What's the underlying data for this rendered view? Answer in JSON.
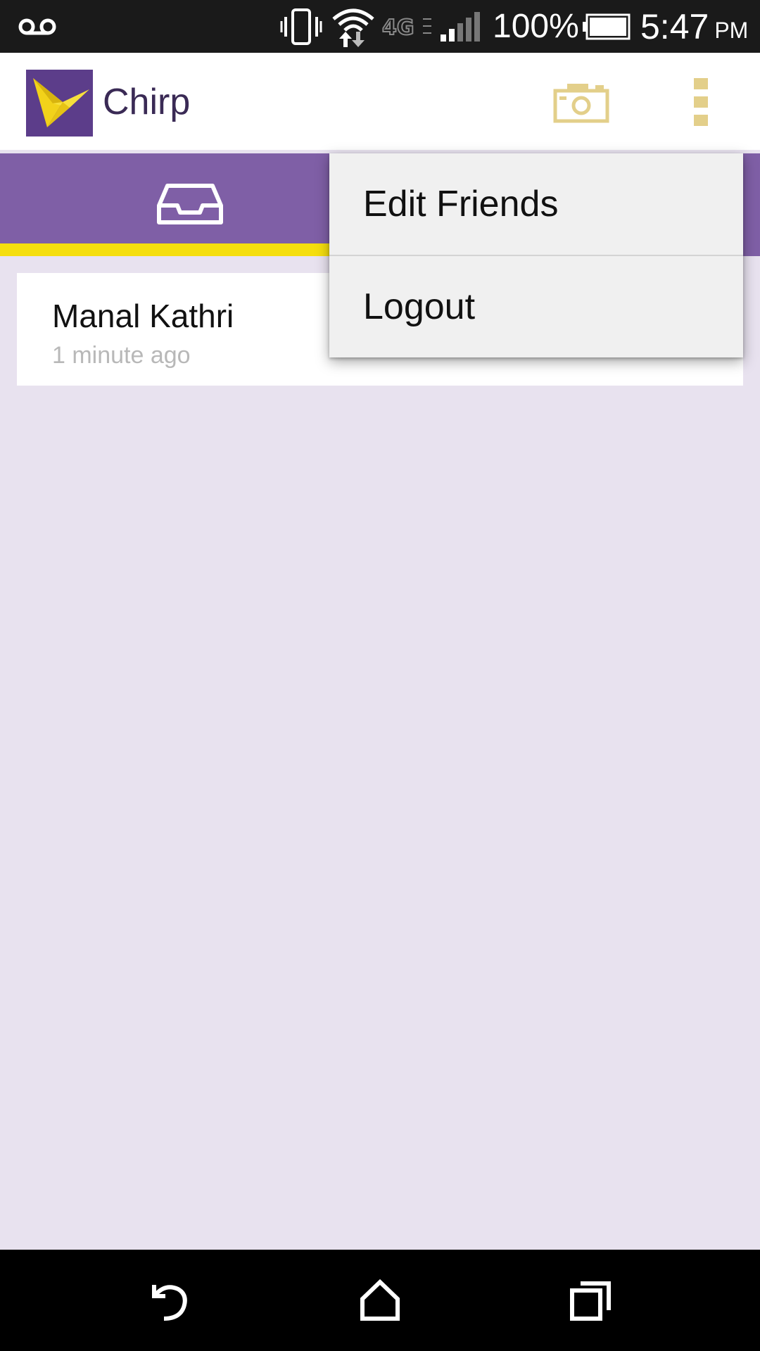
{
  "status_bar": {
    "battery_percent": "100%",
    "time": "5:47",
    "ampm": "PM",
    "network_label": "4G",
    "icons": [
      "voicemail-icon",
      "vibrate-icon",
      "wifi-icon",
      "4g-lte-icon",
      "signal-icon",
      "battery-icon"
    ]
  },
  "app_bar": {
    "title": "Chirp",
    "logo_icon": "bird-logo-icon",
    "camera_icon": "camera-icon",
    "overflow_icon": "overflow-menu-icon"
  },
  "tabs": [
    {
      "icon": "inbox-icon",
      "selected": true
    }
  ],
  "inbox": {
    "items": [
      {
        "sender": "Manal Kathri",
        "time": "1 minute ago"
      }
    ]
  },
  "overflow_menu": {
    "items": [
      {
        "label": "Edit Friends"
      },
      {
        "label": "Logout"
      }
    ]
  },
  "nav_bar": {
    "icons": [
      "back-icon",
      "home-icon",
      "recents-icon"
    ]
  },
  "colors": {
    "status_bar_bg": "#1a1a1a",
    "app_bar_bg": "#ffffff",
    "tab_strip_bg": "#7f5fa6",
    "tab_indicator": "#f5de0e",
    "accent_icon": "#e3cf8a",
    "content_bg": "#e8e2ef",
    "menu_bg": "#f0f0f0",
    "title_text": "#3a2a55"
  }
}
